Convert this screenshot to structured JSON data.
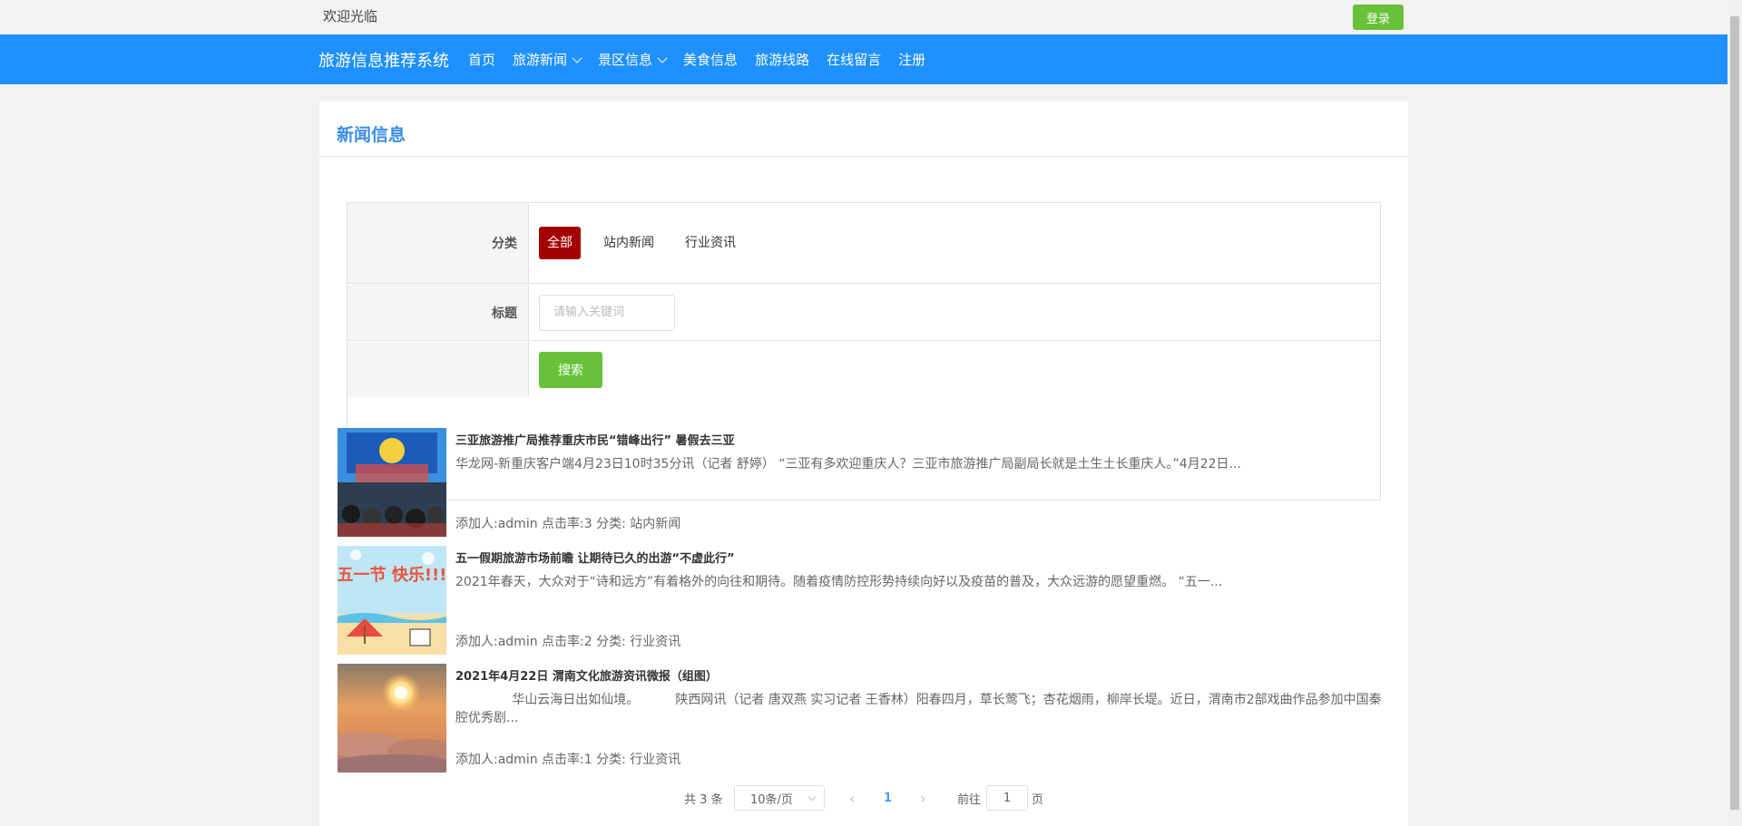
{
  "topbar": {
    "welcome": "欢迎光临",
    "login_label": "登录"
  },
  "navbar": {
    "brand": "旅游信息推荐系统",
    "items": [
      {
        "label": "首页",
        "dropdown": false
      },
      {
        "label": "旅游新闻",
        "dropdown": true
      },
      {
        "label": "景区信息",
        "dropdown": true
      },
      {
        "label": "美食信息",
        "dropdown": false
      },
      {
        "label": "旅游线路",
        "dropdown": false
      },
      {
        "label": "在线留言",
        "dropdown": false
      },
      {
        "label": "注册",
        "dropdown": false
      }
    ]
  },
  "panel": {
    "title": "新闻信息"
  },
  "filter": {
    "category_label": "分类",
    "categories": [
      "全部",
      "站内新闻",
      "行业资讯"
    ],
    "active_category": "全部",
    "title_label": "标题",
    "title_placeholder": "请输入关键词",
    "search_label": "搜索"
  },
  "news": [
    {
      "title": "三亚旅游推广局推荐重庆市民“错峰出行” 暑假去三亚",
      "summary": "华龙网-新重庆客户端4月23日10时35分讯（记者 舒婷） “三亚有多欢迎重庆人？三亚市旅游推广局副局长就是土生土长重庆人。”4月22日...",
      "meta": "添加人:admin  点击率:3  分类: 站内新闻",
      "image": "event-photo"
    },
    {
      "title": "五一假期旅游市场前瞻 让期待已久的出游“不虚此行”",
      "summary": "2021年春天，大众对于“诗和远方”有着格外的向往和期待。随着疫情防控形势持续向好以及疫苗的普及，大众远游的愿望重燃。 “五一...",
      "meta": "添加人:admin  点击率:2  分类: 行业资讯",
      "image": "holiday-poster",
      "image_text": "五一节 快乐!!!"
    },
    {
      "title": "2021年4月22日 渭南文化旅游资讯微报（组图）",
      "summary": "              华山云海日出如仙境。         陕西网讯（记者 唐双燕 实习记者 王香林）阳春四月，草长莺飞；杏花烟雨，柳岸长堤。近日，渭南市2部戏曲作品参加中国秦腔优秀剧...",
      "meta": "添加人:admin  点击率:1  分类: 行业资讯",
      "image": "sunrise-photo"
    }
  ],
  "pager": {
    "total": "共 3 条",
    "page_size": "10条/页",
    "current_page": "1",
    "goto_label": "前往",
    "goto_value": "1",
    "page_unit": "页"
  },
  "colors": {
    "nav_bg": "#1e90ff",
    "accent_green": "#67c23a",
    "active_red": "#a30000",
    "title_blue": "#3a8ee6"
  }
}
